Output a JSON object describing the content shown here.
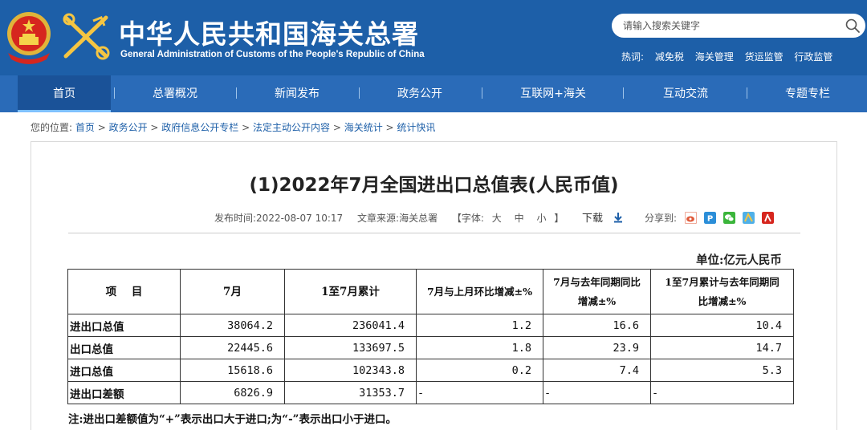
{
  "header": {
    "title_cn": "中华人民共和国海关总署",
    "title_en": "General Administration of Customs of the People's Republic of China",
    "search_placeholder": "请输入搜索关键字",
    "hot_label": "热词:",
    "hot_words": [
      "减免税",
      "海关管理",
      "货运监管",
      "行政监管"
    ]
  },
  "nav": {
    "items": [
      "首页",
      "总署概况",
      "新闻发布",
      "政务公开",
      "互联网+海关",
      "互动交流",
      "专题专栏"
    ],
    "active_index": 0
  },
  "breadcrumb": {
    "prefix": "您的位置:",
    "items": [
      "首页",
      "政务公开",
      "政府信息公开专栏",
      "法定主动公开内容",
      "海关统计",
      "统计快讯"
    ],
    "separator": " > "
  },
  "article": {
    "title": "(1)2022年7月全国进出口总值表(人民币值)",
    "publish_label": "发布时间:",
    "publish_time": "2022-08-07 10:17",
    "source_label": "文章来源:",
    "source": "海关总署",
    "font_label": "【字体:",
    "font_sizes": [
      "大",
      "中",
      "小"
    ],
    "font_close": "】",
    "download": "下载",
    "share_label": "分享到:",
    "unit": "单位:亿元人民币",
    "note": "注:进出口差额值为“+”表示出口大于进口;为“-”表示出口小于进口。"
  },
  "table": {
    "headers": [
      "项    目",
      "7月",
      "1至7月累计",
      "7月与上月环比增减±%",
      "7月与去年同期同比增减±%",
      "1至7月累计与去年同期同比增减±%"
    ],
    "header_lines": [
      [
        "项    目"
      ],
      [
        "7月"
      ],
      [
        "1至7月累计"
      ],
      [
        "7月与上月环比增减±%"
      ],
      [
        "7月与去年同期同比",
        "增减±%"
      ],
      [
        "1至7月累计与去年同期同",
        "比增减±%"
      ]
    ],
    "rows": [
      [
        "进出口总值",
        "38064.2",
        "236041.4",
        "1.2",
        "16.6",
        "10.4"
      ],
      [
        "出口总值",
        "22445.6",
        "133697.5",
        "1.8",
        "23.9",
        "14.7"
      ],
      [
        "进口总值",
        "15618.6",
        "102343.8",
        "0.2",
        "7.4",
        "5.3"
      ],
      [
        "进出口差额",
        "6826.9",
        "31353.7",
        "-",
        "-",
        "-"
      ]
    ]
  },
  "colors": {
    "header_bg": "#1d5fa8",
    "nav_bg": "#2a6bb8",
    "nav_active": "#1a5298"
  }
}
